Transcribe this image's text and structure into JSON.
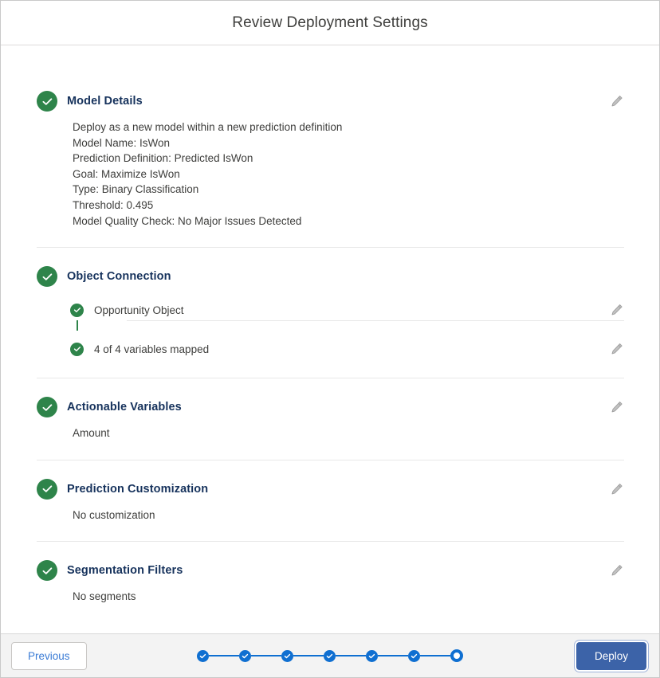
{
  "header": {
    "title": "Review Deployment Settings"
  },
  "sections": [
    {
      "id": "model-details",
      "title": "Model Details",
      "status_icon": "check-circle-icon",
      "edit_icon": "pencil-icon",
      "lines": [
        "Deploy as a new model within a new prediction definition",
        "Model Name: IsWon",
        "Prediction Definition: Predicted IsWon",
        "Goal: Maximize IsWon",
        "Type: Binary Classification",
        "Threshold: 0.495",
        "Model Quality Check: No Major Issues Detected"
      ]
    },
    {
      "id": "object-connection",
      "title": "Object Connection",
      "status_icon": "check-circle-icon",
      "subitems": [
        {
          "label": "Opportunity Object",
          "status_icon": "check-circle-icon",
          "edit_icon": "pencil-icon"
        },
        {
          "label": "4 of 4 variables mapped",
          "status_icon": "check-circle-icon",
          "edit_icon": "pencil-icon"
        }
      ]
    },
    {
      "id": "actionable-variables",
      "title": "Actionable Variables",
      "status_icon": "check-circle-icon",
      "edit_icon": "pencil-icon",
      "lines": [
        "Amount"
      ]
    },
    {
      "id": "prediction-customization",
      "title": "Prediction Customization",
      "status_icon": "check-circle-icon",
      "edit_icon": "pencil-icon",
      "lines": [
        "No customization"
      ]
    },
    {
      "id": "segmentation-filters",
      "title": "Segmentation Filters",
      "status_icon": "check-circle-icon",
      "edit_icon": "pencil-icon",
      "lines": [
        "No segments"
      ]
    }
  ],
  "footer": {
    "previous_label": "Previous",
    "deploy_label": "Deploy",
    "stepper": {
      "total": 7,
      "current": 7,
      "completed": 6,
      "steps": [
        {
          "state": "complete"
        },
        {
          "state": "complete"
        },
        {
          "state": "complete"
        },
        {
          "state": "complete"
        },
        {
          "state": "complete"
        },
        {
          "state": "complete"
        },
        {
          "state": "current"
        }
      ]
    }
  },
  "colors": {
    "success_green": "#2e844a",
    "step_blue": "#0f6fd1",
    "deploy_blue": "#3c63a8",
    "link_blue": "#3a7bd5",
    "title_navy": "#16325c",
    "body_text": "#3e3e3c"
  }
}
